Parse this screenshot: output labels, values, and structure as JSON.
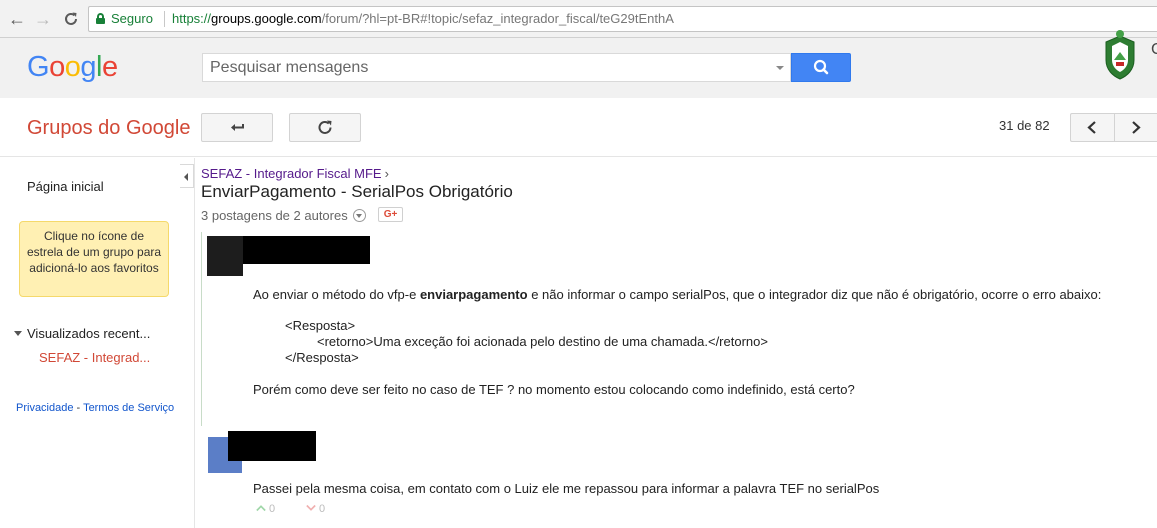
{
  "browser": {
    "secure_label": "Seguro",
    "url_scheme": "https://",
    "url_host": "groups.google.com",
    "url_path": "/forum/?hl=pt-BR#!topic/sefaz_integrador_fiscal/teG29tEnthA"
  },
  "header": {
    "logo_letters": [
      "G",
      "o",
      "o",
      "g",
      "l",
      "e"
    ],
    "logo_colors": [
      "#4285f4",
      "#ea4335",
      "#fbbc05",
      "#4285f4",
      "#34a853",
      "#ea4335"
    ],
    "search_placeholder": "Pesquisar mensagens",
    "crest_text": "C"
  },
  "toolbar": {
    "title": "Grupos do Google",
    "page_count": "31 de 82"
  },
  "sidebar": {
    "home": "Página inicial",
    "tip": "Clique no ícone de estrela de um grupo para adicioná-lo aos favoritos",
    "recent_heading": "Visualizados recent...",
    "recent_item": "SEFAZ - Integrad...",
    "footer_privacy": "Privacidade",
    "footer_dash": " - ",
    "footer_terms": "Termos de Serviço"
  },
  "topic": {
    "breadcrumb": "SEFAZ - Integrador Fiscal MFE",
    "breadcrumb_sep": "›",
    "title": "EnviarPagamento - SerialPos Obrigatório",
    "post_count": "3 postagens de 2 autores",
    "gplus_label": "G+"
  },
  "messages": [
    {
      "line1_pre": "Ao enviar o método do vfp-e ",
      "line1_bold": "enviarpagamento",
      "line1_post": " e não informar o campo serialPos, que o integrador diz que não é obrigatório, ocorre o erro abaixo:",
      "code1": "<Resposta>",
      "code2": "<retorno>Uma exceção foi acionada pelo destino de uma chamada.</retorno>",
      "code3": "</Resposta>",
      "line2": "Porém como deve ser feito no caso de TEF ? no momento estou colocando como indefinido, está certo?"
    },
    {
      "line1": "Passei pela mesma coisa, em contato com o Luiz ele me repassou para informar a palavra TEF no serialPos",
      "upvotes": "0",
      "downvotes": "0"
    }
  ]
}
